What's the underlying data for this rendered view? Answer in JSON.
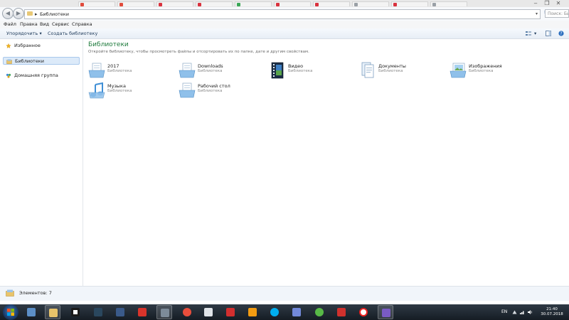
{
  "window": {
    "background_tabs": [
      "",
      "",
      "",
      "",
      "",
      "",
      "",
      "",
      "",
      ""
    ],
    "controls": [
      "‒",
      "❐",
      "✕"
    ]
  },
  "address": {
    "path": "Библиотеки",
    "search_placeholder": "Поиск: Биб..."
  },
  "menu": [
    "Файл",
    "Правка",
    "Вид",
    "Сервис",
    "Справка"
  ],
  "commands": {
    "organize": "Упорядочить ▾",
    "new_library": "Создать библиотеку"
  },
  "nav": {
    "favorites": "Избранное",
    "libraries": "Библиотеки",
    "homegroup": "Домашняя группа"
  },
  "content": {
    "title": "Библиотеки",
    "subtitle": "Откройте библиотеку, чтобы просмотреть файлы и отсортировать их по папке, дате и другим свойствам.",
    "libraries": [
      {
        "name": "2017",
        "kind": "Библиотека",
        "icon": "docs"
      },
      {
        "name": "Downloads",
        "kind": "Библиотека",
        "icon": "docs"
      },
      {
        "name": "Видео",
        "kind": "Библиотека",
        "icon": "video"
      },
      {
        "name": "Документы",
        "kind": "Библиотека",
        "icon": "docs"
      },
      {
        "name": "Изображения",
        "kind": "Библиотека",
        "icon": "pictures"
      },
      {
        "name": "Музыка",
        "kind": "Библиотека",
        "icon": "music"
      },
      {
        "name": "Рабочий стол",
        "kind": "Библиотека",
        "icon": "docs"
      }
    ]
  },
  "status": {
    "count": "Элементов: 7"
  },
  "taskbar": {
    "apps": [
      "computer-icon",
      "explorer-icon",
      "roblox-icon",
      "steam-icon",
      "unity-dark-icon",
      "app-red-icon",
      "video-editor-icon",
      "chrome-like-icon",
      "unity-icon",
      "red-app-icon",
      "fl-studio-icon",
      "skype-icon",
      "discord-icon",
      "utorrent-icon",
      "download-icon",
      "yandex-icon",
      "purple-app-icon"
    ],
    "lang": "EN",
    "time": "21:40",
    "date": "30.07.2018"
  },
  "colors": {
    "accent": "#1e7a3c",
    "selection": "#dceaf9",
    "taskbar": "#1c242d"
  }
}
